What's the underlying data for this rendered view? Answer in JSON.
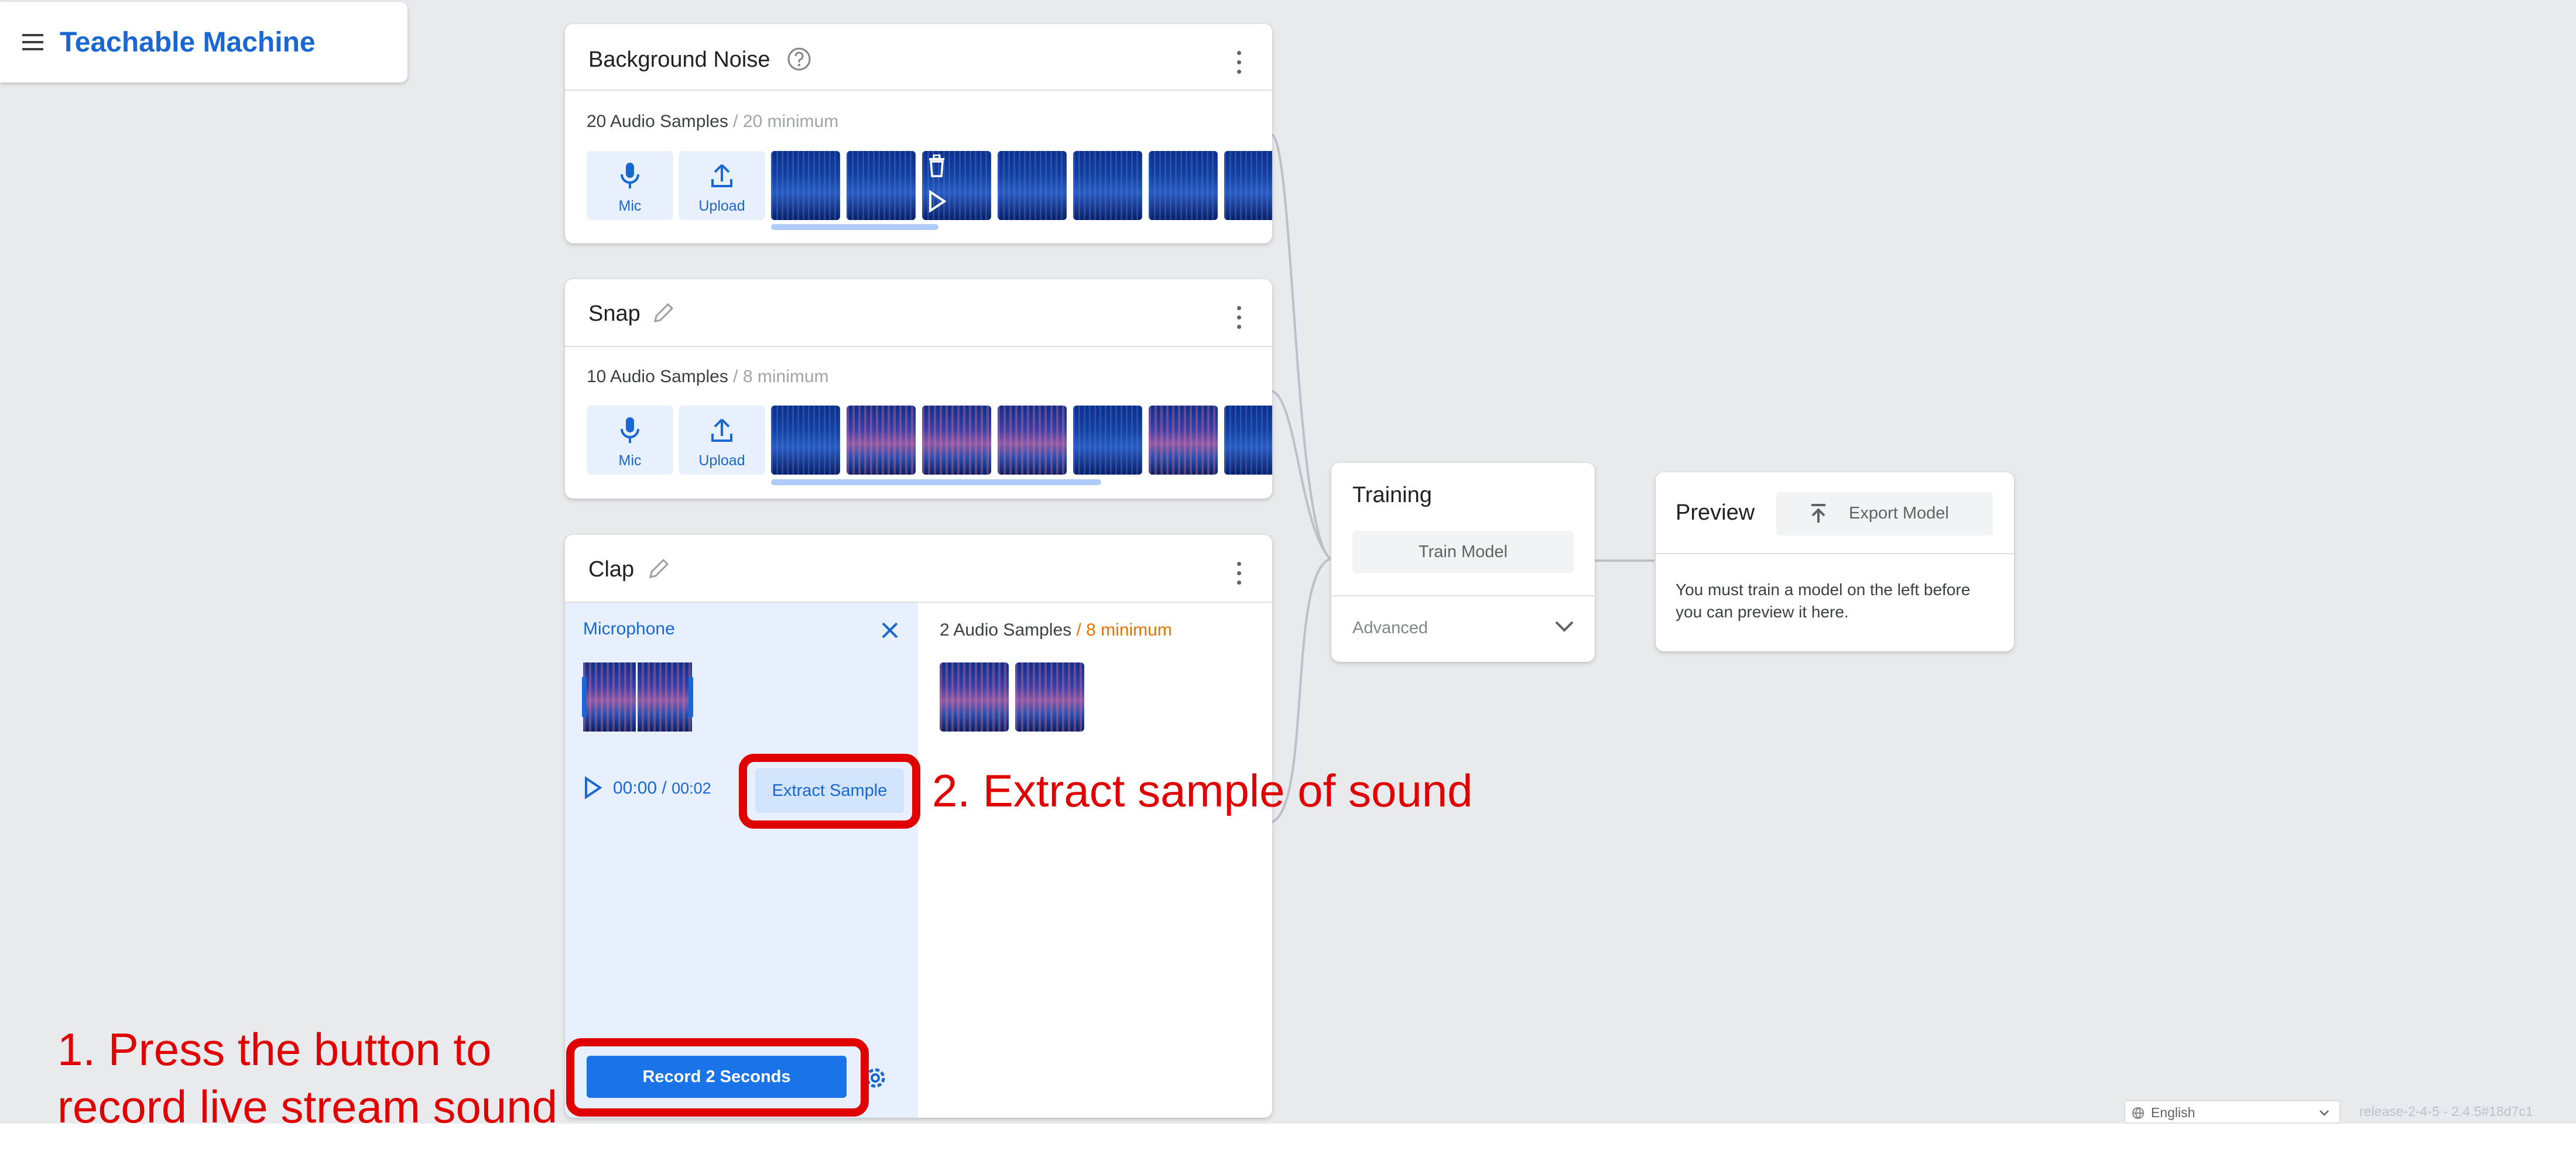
{
  "app": {
    "title": "Teachable Machine"
  },
  "classes": [
    {
      "name": "Background Noise",
      "samples_count": "20 Audio Samples",
      "samples_min": " / 20 minimum",
      "mic_label": "Mic",
      "upload_label": "Upload"
    },
    {
      "name": "Snap",
      "samples_count": "10 Audio Samples",
      "samples_min": " / 8 minimum",
      "mic_label": "Mic",
      "upload_label": "Upload"
    },
    {
      "name": "Clap",
      "samples_count": "2 Audio Samples",
      "samples_min": " / 8 minimum"
    }
  ],
  "recorder": {
    "title": "Microphone",
    "time_current": "00:00",
    "time_total": "00:02",
    "extract_label": "Extract Sample",
    "record_label": "Record 2 Seconds"
  },
  "training": {
    "title": "Training",
    "train_label": "Train Model",
    "advanced_label": "Advanced"
  },
  "preview": {
    "title": "Preview",
    "export_label": "Export Model",
    "message": "You must train a model on the left before you can preview it here."
  },
  "footer": {
    "language": "English",
    "release": "release-2-4-5 - 2.4.5#18d7c1"
  },
  "annotations": {
    "step1_line1": "1. Press the button to",
    "step1_line2": "record live stream sound",
    "step2": "2. Extract sample of sound"
  },
  "colors": {
    "accent": "#1967d2",
    "annotation_red": "#e00000",
    "warning": "#e37400",
    "canvas_bg": "#e8eaed"
  },
  "icons": [
    "menu-icon",
    "help-icon",
    "pencil-icon",
    "kebab-menu-icon",
    "mic-icon",
    "upload-icon",
    "trash-icon",
    "play-icon",
    "close-icon",
    "gear-icon",
    "chevron-down-icon",
    "export-icon",
    "globe-icon"
  ]
}
